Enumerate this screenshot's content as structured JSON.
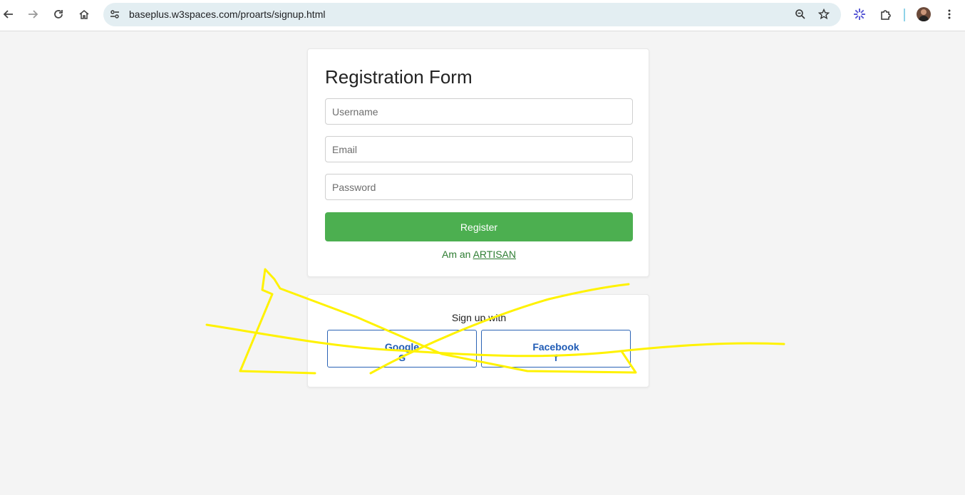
{
  "browser": {
    "url": "baseplus.w3spaces.com/proarts/signup.html",
    "icons": [
      "back-arrow-icon",
      "forward-arrow-icon",
      "reload-icon",
      "home-icon",
      "site-info-icon",
      "zoom-icon",
      "bookmark-star-icon",
      "extension-icon",
      "puzzle-icon",
      "profile-avatar",
      "menu-dots-icon"
    ]
  },
  "registration": {
    "title": "Registration Form",
    "username_placeholder": "Username",
    "email_placeholder": "Email",
    "password_placeholder": "Password",
    "register_label": "Register",
    "artisan_prefix": "Am an",
    "artisan_link": "ARTISAN"
  },
  "social": {
    "title": "Sign up with",
    "google_label": "Google",
    "google_icon": "G",
    "facebook_label": "Facebook",
    "facebook_icon": "f"
  },
  "colors": {
    "accent_green": "#4caf50",
    "link_green": "#2e7d32",
    "social_blue": "#1f5bb5",
    "scribble_yellow": "#fff200"
  }
}
